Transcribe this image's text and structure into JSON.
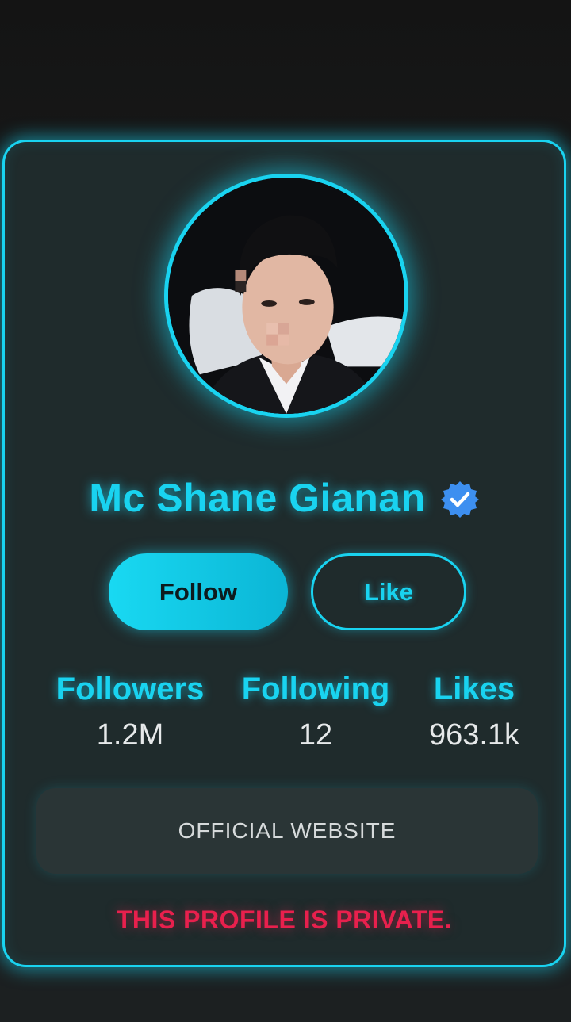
{
  "profile": {
    "name": "Mc Shane Gianan",
    "verified_icon": "verified-badge-icon",
    "avatar": "avatar-photo"
  },
  "actions": {
    "follow_label": "Follow",
    "like_label": "Like"
  },
  "stats": [
    {
      "label": "Followers",
      "value": "1.2M"
    },
    {
      "label": "Following",
      "value": "12"
    },
    {
      "label": "Likes",
      "value": "963.1k"
    }
  ],
  "website": {
    "label": "OFFICIAL WEBSITE"
  },
  "notice": {
    "text": "THIS PROFILE IS PRIVATE."
  },
  "colors": {
    "accent": "#19d3f0",
    "card_background": "#1f2b2c",
    "private_text": "#e8204d",
    "verified_badge": "#3d8ff0"
  }
}
